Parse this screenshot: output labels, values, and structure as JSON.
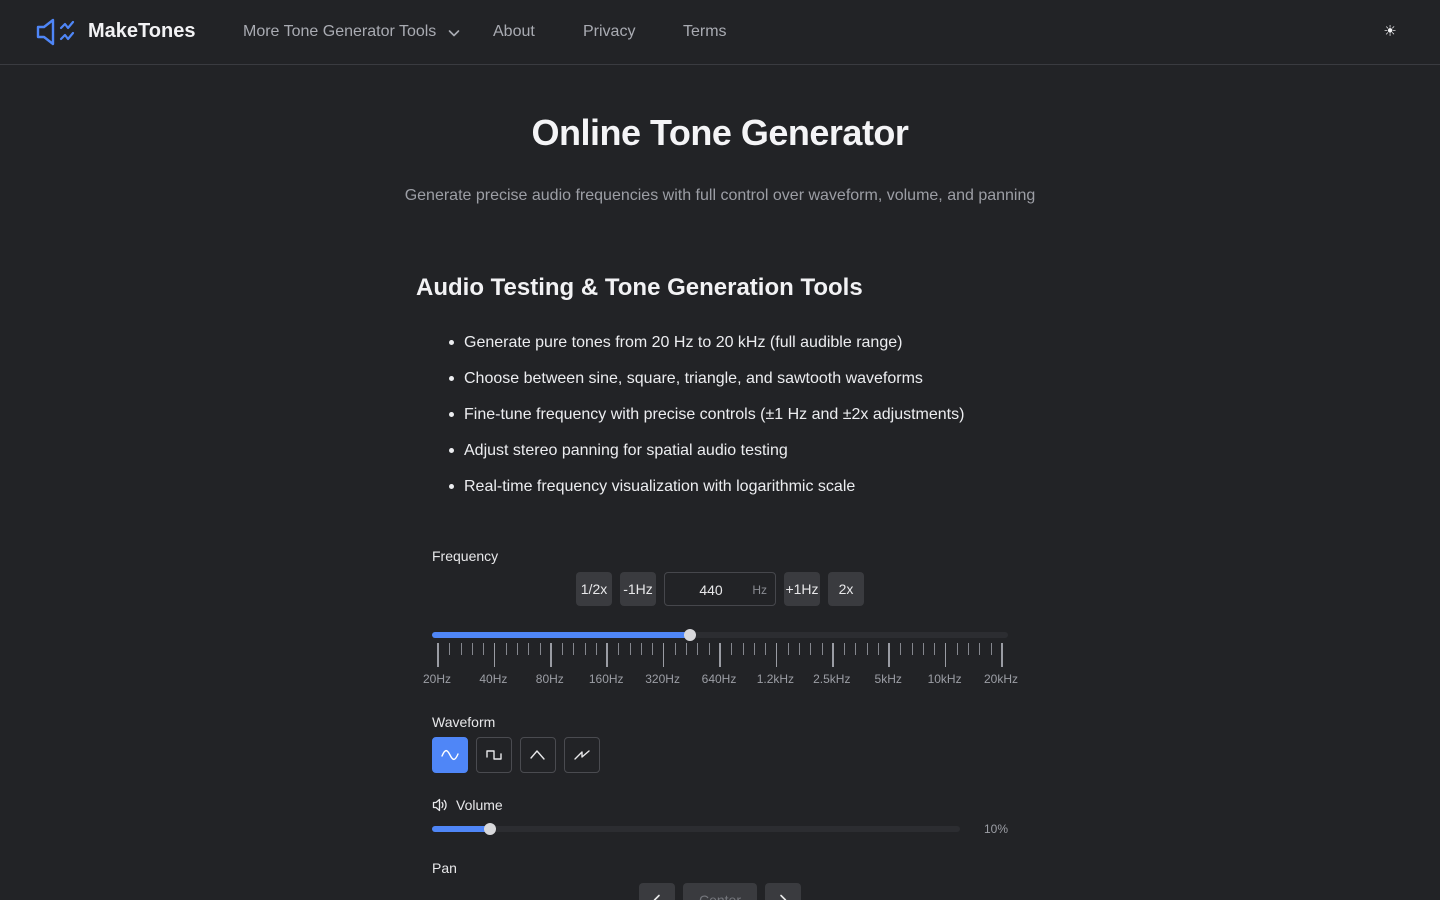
{
  "header": {
    "brand": "MakeTones",
    "logo_icon": "speaker-waves-icon",
    "nav": {
      "tools": "More Tone Generator Tools",
      "about": "About",
      "privacy": "Privacy",
      "terms": "Terms"
    },
    "theme_toggle": "☀"
  },
  "hero": {
    "title": "Online Tone Generator",
    "subtitle": "Generate precise audio frequencies with full control over waveform, volume, and panning"
  },
  "features": {
    "heading": "Audio Testing & Tone Generation Tools",
    "items": [
      "Generate pure tones from 20 Hz to 20 kHz (full audible range)",
      "Choose between sine, square, triangle, and sawtooth waveforms",
      "Fine-tune frequency with precise controls (±1 Hz and ±2x adjustments)",
      "Adjust stereo panning for spatial audio testing",
      "Real-time frequency visualization with logarithmic scale"
    ]
  },
  "frequency": {
    "label": "Frequency",
    "half_label": "1/2x",
    "minus_label": "-1Hz",
    "value": "440",
    "unit": "Hz",
    "plus_label": "+1Hz",
    "double_label": "2x",
    "slider_hz": 440,
    "scale_labels": [
      "20Hz",
      "40Hz",
      "80Hz",
      "160Hz",
      "320Hz",
      "640Hz",
      "1.2kHz",
      "2.5kHz",
      "5kHz",
      "10kHz",
      "20kHz"
    ]
  },
  "waveform": {
    "label": "Waveform",
    "options": [
      "sine",
      "square",
      "triangle",
      "sawtooth"
    ],
    "selected": "sine"
  },
  "volume": {
    "label": "Volume",
    "value_text": "10%",
    "level": 0.1
  },
  "pan": {
    "label": "Pan",
    "value": "Center"
  },
  "colors": {
    "accent": "#4f86f7",
    "background": "#222326"
  }
}
